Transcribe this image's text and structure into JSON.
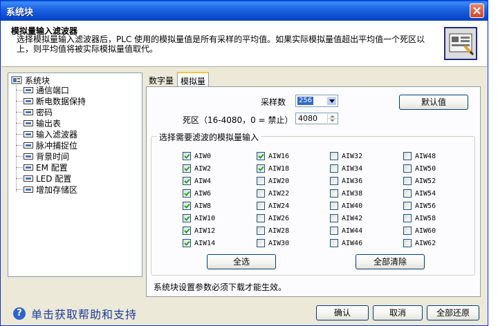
{
  "window": {
    "title": "系统块"
  },
  "header": {
    "title": "模拟量输入滤波器",
    "description": "选择模拟量输入滤波器后，PLC 使用的模拟量值是所有采样的平均值。如果实际模拟量值超出平均值一个死区以上，则平均值将被实际模拟量值取代。"
  },
  "tree": {
    "root": "系统块",
    "items": [
      "通信端口",
      "断电数据保持",
      "密码",
      "输出表",
      "输入滤波器",
      "脉冲捕捉位",
      "背景时间",
      "EM 配置",
      "LED 配置",
      "增加存储区"
    ]
  },
  "tabs": [
    {
      "label": "数字量"
    },
    {
      "label": "模拟量"
    }
  ],
  "panel": {
    "samples_label": "采样数",
    "samples_value": "256",
    "deadband_label": "死区（16-4080，0 = 禁止）",
    "deadband_value": "4080",
    "default_button": "默认值",
    "group_title": "选择需要滤波的模拟量输入",
    "select_all": "全选",
    "clear_all": "全部清除",
    "note": "系统块设置参数必须下载才能生效。"
  },
  "inputs": {
    "col1": [
      {
        "label": "AIW0",
        "checked": true
      },
      {
        "label": "AIW2",
        "checked": true
      },
      {
        "label": "AIW4",
        "checked": true
      },
      {
        "label": "AIW6",
        "checked": true
      },
      {
        "label": "AIW8",
        "checked": true
      },
      {
        "label": "AIW10",
        "checked": true
      },
      {
        "label": "AIW12",
        "checked": true
      },
      {
        "label": "AIW14",
        "checked": true
      }
    ],
    "col2": [
      {
        "label": "AIW16",
        "checked": true
      },
      {
        "label": "AIW18",
        "checked": true
      },
      {
        "label": "AIW20",
        "checked": false
      },
      {
        "label": "AIW22",
        "checked": false
      },
      {
        "label": "AIW24",
        "checked": false
      },
      {
        "label": "AIW26",
        "checked": false
      },
      {
        "label": "AIW28",
        "checked": false
      },
      {
        "label": "AIW30",
        "checked": false
      }
    ],
    "col3": [
      {
        "label": "AIW32",
        "checked": false
      },
      {
        "label": "AIW34",
        "checked": false
      },
      {
        "label": "AIW36",
        "checked": false
      },
      {
        "label": "AIW38",
        "checked": false
      },
      {
        "label": "AIW40",
        "checked": false
      },
      {
        "label": "AIW42",
        "checked": false
      },
      {
        "label": "AIW44",
        "checked": false
      },
      {
        "label": "AIW46",
        "checked": false
      }
    ],
    "col4": [
      {
        "label": "AIW48",
        "checked": false
      },
      {
        "label": "AIW50",
        "checked": false
      },
      {
        "label": "AIW52",
        "checked": false
      },
      {
        "label": "AIW54",
        "checked": false
      },
      {
        "label": "AIW56",
        "checked": false
      },
      {
        "label": "AIW58",
        "checked": false
      },
      {
        "label": "AIW60",
        "checked": false
      },
      {
        "label": "AIW62",
        "checked": false
      }
    ]
  },
  "footer": {
    "help_text": "单击获取帮助和支持",
    "ok": "确认",
    "cancel": "取消",
    "restore_all": "全部还原"
  },
  "colors": {
    "titlebar": "#0a5fdf",
    "accent": "#316ac5",
    "tab_highlight": "#f6c33b"
  }
}
